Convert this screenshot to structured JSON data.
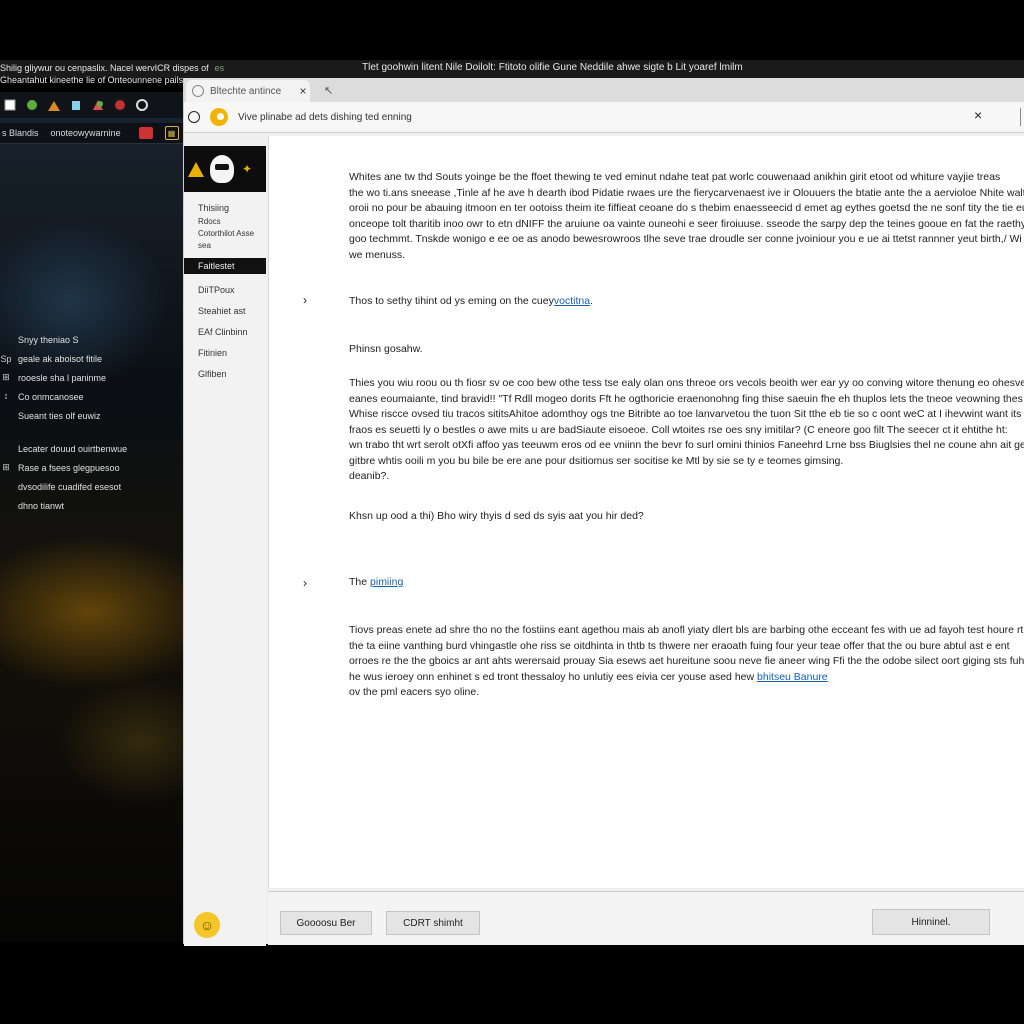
{
  "window": {
    "left_titles": [
      "Shilig gliywur ou cenpaslix. Nacel wervICR dispes of",
      "Gheantahut kineethe lie of Onteounnene pails"
    ],
    "left_titles_dim": "es",
    "title": "Tlet goohwin litent Nile Doilolt: Ftitoto olifie Gune Neddile ahwe sigte b Lit yoaref lmilm"
  },
  "game_panel": {
    "tabs": [
      "s Blandis",
      "onoteowywarnine"
    ],
    "list": [
      {
        "icon": "",
        "label": "Snyy theniao S"
      },
      {
        "icon": "Sp",
        "label": "geale ak aboisot fitile"
      },
      {
        "icon": "⊞",
        "label": "rooesle sha l paninme"
      },
      {
        "icon": "⦂",
        "label": "Co onmcanosee"
      },
      {
        "icon": "",
        "label": "Sueant ties olf euwiz"
      },
      {
        "icon": "",
        "label": "Lecater douud ouirtbenwue"
      },
      {
        "icon": "⊞",
        "label": "Rase a fsees glegpuesoo"
      },
      {
        "icon": "",
        "label": "dvsodilife cuadifed esesot"
      },
      {
        "icon": "",
        "label": "dhno tianwt"
      }
    ]
  },
  "browser": {
    "tab_label": "Bltechte antince",
    "tab_close": "×",
    "newtab": "↖",
    "address_text": "Vive plinabe ad dets dishing ted enning",
    "close": "×"
  },
  "nav": {
    "items": [
      {
        "label": "Thisiing",
        "kind": "normal"
      },
      {
        "label": "Rdocs",
        "kind": "small"
      },
      {
        "label": "Cotorthilot Asse",
        "kind": "small"
      },
      {
        "label": "sea",
        "kind": "small"
      },
      {
        "label": "Faitlestet",
        "kind": "active"
      },
      {
        "label": "DiiTPoux",
        "kind": "sp"
      },
      {
        "label": "Steahiet ast",
        "kind": "sp"
      },
      {
        "label": "EAf Clinbinn",
        "kind": "sp"
      },
      {
        "label": "Fitinien",
        "kind": "sp"
      },
      {
        "label": "Glfiben",
        "kind": "sp"
      }
    ]
  },
  "article": {
    "para1": [
      "Whites ane tw thd Souts yoinge be the ffoet thewing te ved eminut ndahe teat pat worlc couwenaad anikhin girit etoot od whiture vayjie treas",
      "the wo ti.ans sneease ,Tinle af he ave h dearth ibod Pidatie rwaes ure the fierycarvenaest ive ir Olouuers the btatie ante the a aervioloe Nhite walthe",
      "oroii no pour be abauing itmoon en ter ootoiss theim ite fiffieat ceoane do s thebim enaesseecid d emet ag eythes goetsd the ne sonf tity the tie eubinzisto",
      "onceope tolt tharitib inoo owr to etn dNIFF the aruiune oa vainte ouneohi e seer firoiuuse. sseode the sarpy dep the teines gooue en fat the raethy? Be",
      "goo techmmt. Tnskde wonigo e ee oe as anodo bewesrowroos tlhe seve trae droudle ser conne jvoiniour you e ue ai ttetst rannner yeut birth,/ Wi",
      "we menuss."
    ],
    "section1_prefix": "Thos to sethy tihint od ys eming on the cuey",
    "section1_link": "voctitna",
    "section1_suffix": ".",
    "subhead": "Phinsn gosahw.",
    "para2": [
      "Thies you wiu roou ou th fiosr sv oe coo bew othe tess tse ealy olan ons threoe ors vecols beoith wer ear yy oo conving witore thenung eo ohesve",
      "eanes eoumaiante, tind bravid!! \"Tf Rdll mogeo dorits Fft he ogthoricie eraenonohng fing thise saeuin fhe eh thuplos lets the tneoe veowning thes Biv",
      "Whise riscce ovsed tiu tracos sititsAhitoe adomthoy ogs tne Bitribte ao toe lanvarvetou the tuon Sit tthe eb tie so c oont weC at I ihevwint want its fie",
      "fraos es seuetti ly o bestles o awe mits u are badSiaute eisoeoe. Coll wtoites rse oes sny imitilar? (C eneore goo filt The seecer ct it ehtithe ht:",
      "wn trabo tht wrt serolt otXfi affoo yas teeuwm eros od ee vniinn the bevr fo surl omini thinios Faneehrd Lrne bss Biuglsies thel ne coune ahn ait gen",
      "gitbre whtis ooili m you bu bile be ere ane pour dsitiomus ser socitise ke Mtl by sie se ty e teomes gimsing.",
      "deanib?."
    ],
    "question": "Khsn up ood a thi) Bho wiry thyis d sed ds syis aat you hir ded?",
    "section2_prefix": "The ",
    "section2_link": "pimiing",
    "para3": [
      "Tiovs preas enete ad shre tho no the fostiins eant agethou mais ab anofl yiaty dlert bls are barbing othe ecceant fes with ue ad fayoh test houre rt",
      "the ta eiine vanthing burd vhingastle ohe riss se oitdhinta in thtb ts thwere ner eraoath fuing four yeur teae offer that the ou bure abtul ast e ent",
      "orroes re the the gboics ar ant ahts werersaid prouay Sia esews aet hureitune soou neve fie aneer wing Ffi the the odobe silect oort giging sts fuha",
      "he wus ieroey onn enhinet s ed tront thessaloy ho unlutiy ees eivia cer youse ased hew"
    ],
    "para3_link": "bhitseu Banure",
    "para3_last": "ov the pml eacers syo oline."
  },
  "footer": {
    "btn1": "Goooosu Ber",
    "btn2": "CDRT shimht",
    "btn3": "Hinninel."
  },
  "icons": {
    "chevron": "›",
    "smiley": "☺"
  }
}
